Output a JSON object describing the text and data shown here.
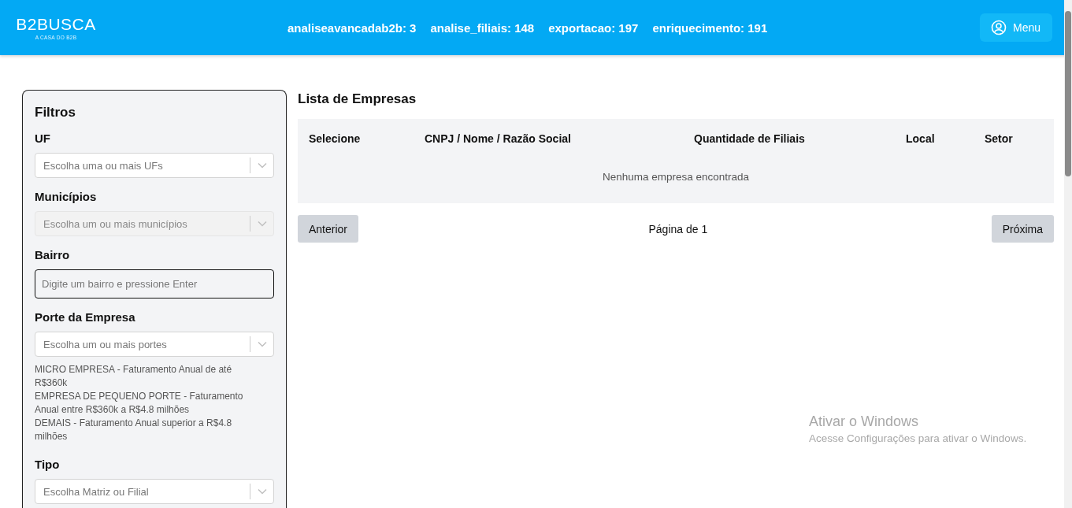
{
  "header": {
    "logo": "B2BUSCA",
    "tagline": "A CASA DO B2B",
    "counters": [
      {
        "label": "analiseavancadab2b: 3"
      },
      {
        "label": "analise_filiais: 148"
      },
      {
        "label": "exportacao: 197"
      },
      {
        "label": "enriquecimento: 191"
      }
    ],
    "menu_button": "Menu"
  },
  "filters": {
    "title": "Filtros",
    "fields": [
      {
        "kind": "select",
        "label": "UF",
        "placeholder": "Escolha uma ou mais UFs"
      },
      {
        "kind": "select",
        "label": "Municípios",
        "placeholder": "Escolha um ou mais municípios",
        "disabled": true
      },
      {
        "kind": "input",
        "label": "Bairro",
        "placeholder": "Digite um bairro e pressione Enter"
      },
      {
        "kind": "select",
        "label": "Porte da Empresa",
        "placeholder": "Escolha um ou mais portes",
        "notes": [
          "MICRO EMPRESA - Faturamento Anual de até R$360k",
          "EMPRESA DE PEQUENO PORTE - Faturamento Anual entre R$360k a R$4.8 milhões",
          "DEMAIS - Faturamento Anual superior a R$4.8 milhões"
        ]
      },
      {
        "kind": "select",
        "label": "Tipo",
        "placeholder": "Escolha Matriz ou Filial"
      }
    ]
  },
  "list": {
    "title": "Lista de Empresas",
    "columns": [
      "Selecione",
      "CNPJ / Nome / Razão Social",
      "Quantidade de Filiais",
      "Local",
      "Setor"
    ],
    "empty_message": "Nenhuma empresa encontrada",
    "pagination": {
      "previous": "Anterior",
      "page_label": "Página de 1",
      "next": "Próxima"
    }
  },
  "os_notice": {
    "title": "Ativar o Windows",
    "text": "Acesse Configurações para ativar o Windows."
  }
}
